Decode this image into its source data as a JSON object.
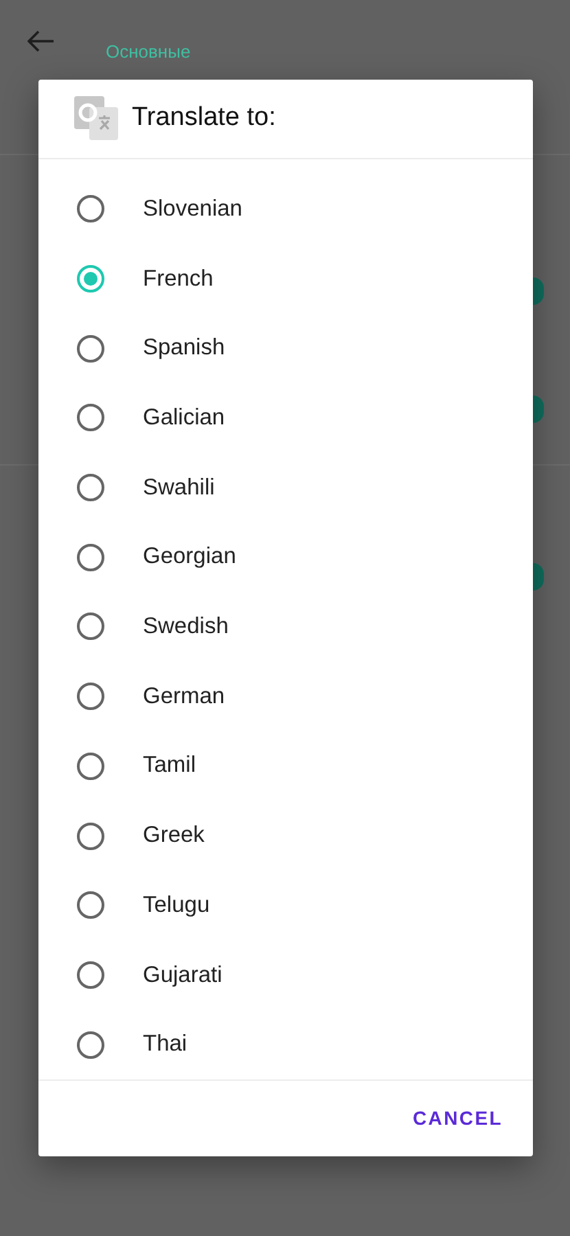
{
  "background": {
    "section_title": "Основные",
    "switches": [
      {
        "on": true
      },
      {
        "on": true
      },
      {
        "on": true
      }
    ]
  },
  "dialog": {
    "title": "Translate to:",
    "options": [
      {
        "label": "Slovenian",
        "selected": false
      },
      {
        "label": "French",
        "selected": true
      },
      {
        "label": "Spanish",
        "selected": false
      },
      {
        "label": "Galician",
        "selected": false
      },
      {
        "label": "Swahili",
        "selected": false
      },
      {
        "label": "Georgian",
        "selected": false
      },
      {
        "label": "Swedish",
        "selected": false
      },
      {
        "label": "German",
        "selected": false
      },
      {
        "label": "Tamil",
        "selected": false
      },
      {
        "label": "Greek",
        "selected": false
      },
      {
        "label": "Telugu",
        "selected": false
      },
      {
        "label": "Gujarati",
        "selected": false
      },
      {
        "label": "Thai",
        "selected": false
      }
    ],
    "cancel": "CANCEL"
  }
}
